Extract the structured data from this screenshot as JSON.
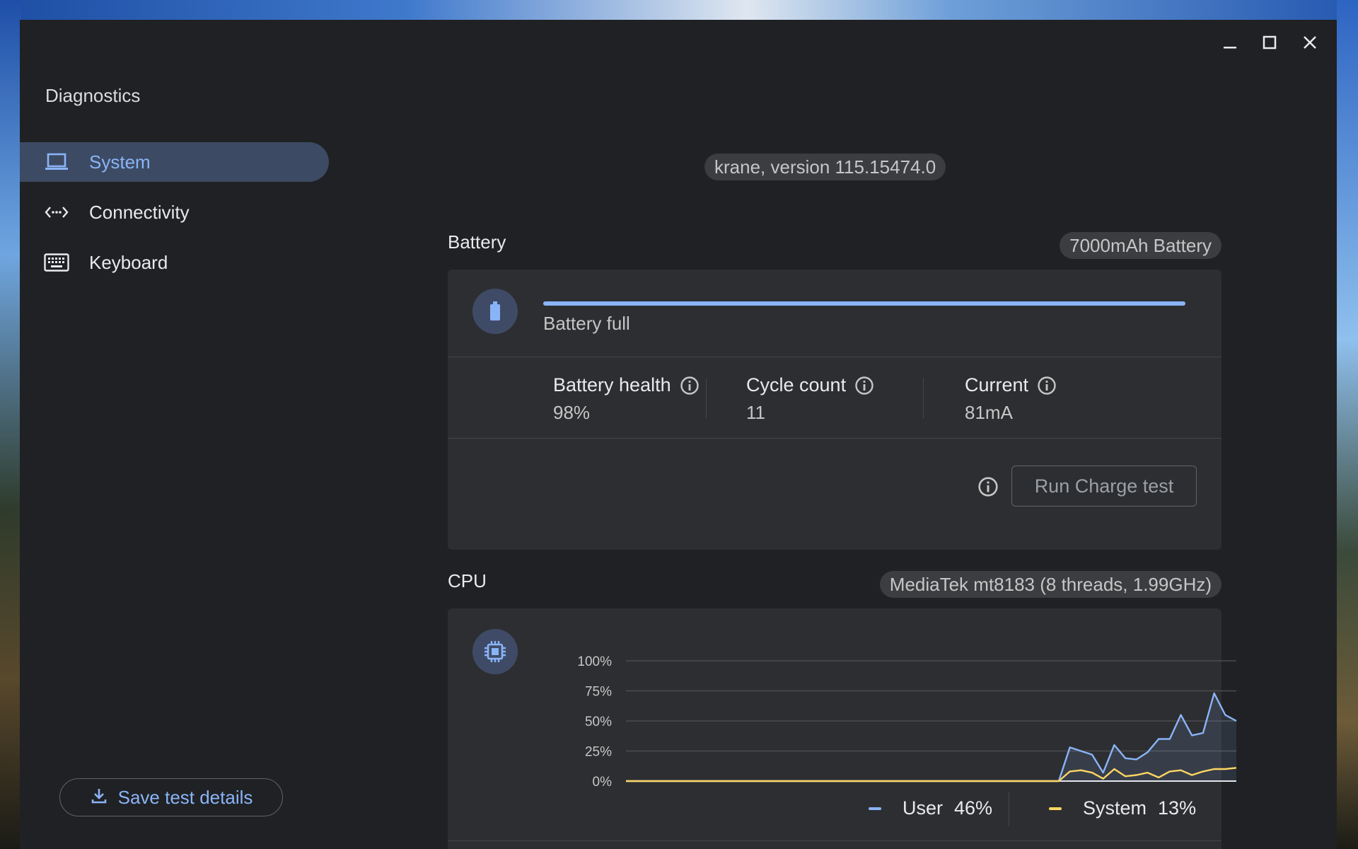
{
  "window": {
    "controls": {
      "minimize": "minimize-icon",
      "maximize": "maximize-icon",
      "close": "close-icon"
    }
  },
  "app": {
    "title": "Diagnostics"
  },
  "sidebar": {
    "items": [
      {
        "label": "System",
        "icon": "laptop-icon",
        "active": true
      },
      {
        "label": "Connectivity",
        "icon": "connectivity-icon",
        "active": false
      },
      {
        "label": "Keyboard",
        "icon": "keyboard-icon",
        "active": false
      }
    ],
    "save_button": {
      "label": "Save test details",
      "icon": "download-icon"
    }
  },
  "system": {
    "version_label": "krane, version 115.15474.0"
  },
  "battery": {
    "title": "Battery",
    "chip": "7000mAh Battery",
    "status": "Battery full",
    "charge_fraction": 1.0,
    "stats": [
      {
        "label": "Battery health",
        "value": "98%"
      },
      {
        "label": "Cycle count",
        "value": "11"
      },
      {
        "label": "Current",
        "value": "81mA"
      }
    ],
    "run_test_label": "Run Charge test"
  },
  "cpu": {
    "title": "CPU",
    "chip": "MediaTek mt8183 (8 threads, 1.99GHz)",
    "legend": [
      {
        "name": "User",
        "value": "46%",
        "color": "#8ab4f8"
      },
      {
        "name": "System",
        "value": "13%",
        "color": "#fdd663"
      }
    ]
  },
  "colors": {
    "accent": "#8ab4f8",
    "system_series": "#fdd663",
    "background": "#202124",
    "card": "#2d2e31"
  },
  "chart_data": {
    "type": "line",
    "title": "",
    "xlabel": "",
    "ylabel": "",
    "ylim": [
      0,
      100
    ],
    "yticks": [
      "100%",
      "75%",
      "50%",
      "25%",
      "0%"
    ],
    "grid": true,
    "legend_placement": "bottom-right",
    "x": [
      0,
      1,
      2,
      3,
      4,
      5,
      6,
      7,
      8,
      9,
      10,
      11,
      12,
      13,
      14,
      15,
      16,
      17,
      18,
      19,
      20,
      21,
      22,
      23,
      24,
      25,
      26,
      27,
      28,
      29,
      30,
      31,
      32,
      33,
      34,
      35,
      36,
      37,
      38,
      39,
      40,
      41,
      42,
      43,
      44,
      45,
      46,
      47
    ],
    "series": [
      {
        "name": "User",
        "color": "#8ab4f8",
        "values": [
          0,
          0,
          0,
          0,
          0,
          0,
          0,
          0,
          0,
          0,
          0,
          0,
          0,
          0,
          0,
          0,
          0,
          0,
          0,
          0,
          0,
          0,
          0,
          0,
          0,
          0,
          0,
          0,
          0,
          0,
          0,
          0,
          0,
          0,
          0,
          0,
          0,
          0,
          0,
          0,
          28,
          25,
          22,
          7,
          30,
          19,
          18,
          24,
          35,
          35,
          55,
          38,
          40,
          73,
          55,
          50
        ]
      },
      {
        "name": "System",
        "color": "#fdd663",
        "values": [
          0,
          0,
          0,
          0,
          0,
          0,
          0,
          0,
          0,
          0,
          0,
          0,
          0,
          0,
          0,
          0,
          0,
          0,
          0,
          0,
          0,
          0,
          0,
          0,
          0,
          0,
          0,
          0,
          0,
          0,
          0,
          0,
          0,
          0,
          0,
          0,
          0,
          0,
          0,
          0,
          8,
          9,
          7,
          2,
          10,
          4,
          5,
          7,
          3,
          8,
          9,
          5,
          8,
          10,
          10,
          11
        ]
      }
    ]
  }
}
